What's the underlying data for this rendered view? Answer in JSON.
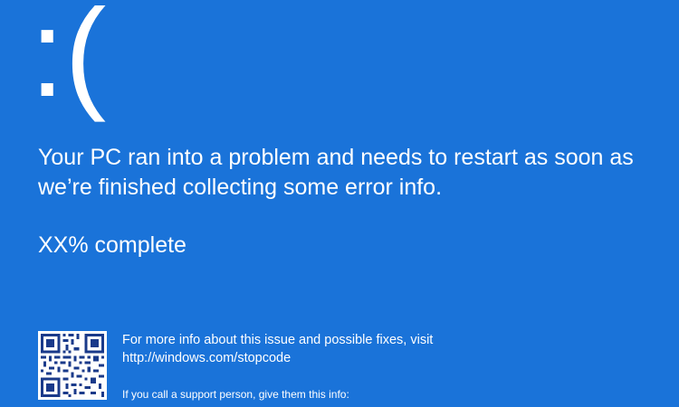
{
  "screen": {
    "background_color": "#1a73d9",
    "text_color": "#ffffff",
    "frown": ":(",
    "message": "Your PC ran into a problem and needs to restart as soon as we’re finished collecting some error info.",
    "progress_text": "XX% complete",
    "more_info_text": "For more info about this issue and possible fixes, visit",
    "stopcode_url": "http://windows.com/stopcode",
    "support_text": "If you call a support person, give them this info:",
    "qr_icon": "qr-code-icon"
  }
}
